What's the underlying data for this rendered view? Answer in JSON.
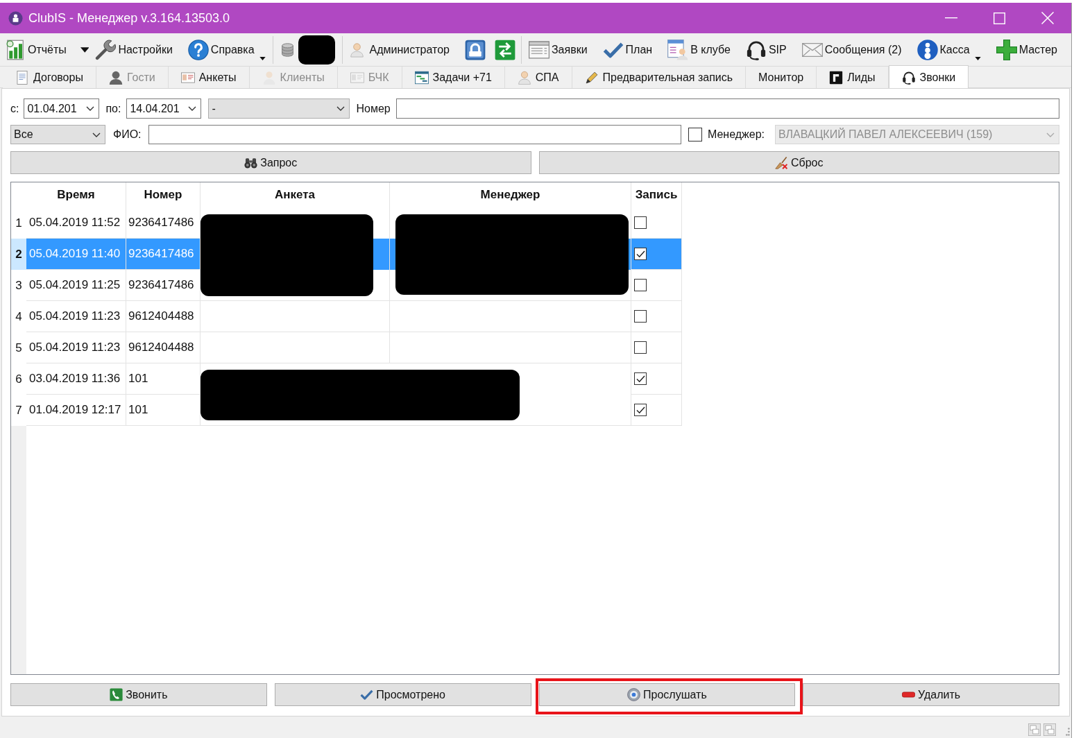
{
  "window": {
    "title": "ClubIS - Менеджер v.3.164.13503.0"
  },
  "toolbar": {
    "groups": [
      [
        {
          "kind": "split",
          "label": "Отчёты"
        },
        {
          "kind": "button",
          "label": "Настройки",
          "menu": false
        },
        {
          "kind": "button",
          "label": "Справка",
          "menu": true
        }
      ],
      [
        {
          "kind": "redacted"
        }
      ],
      [
        {
          "kind": "button",
          "label": "Администратор",
          "menu": false
        },
        {
          "kind": "icon"
        },
        {
          "kind": "icon"
        }
      ]
    ],
    "right": [
      {
        "kind": "button",
        "label": "Заявки",
        "menu": false
      },
      {
        "kind": "button",
        "label": "План",
        "menu": false
      },
      {
        "kind": "button",
        "label": "В клубе",
        "menu": false
      },
      {
        "kind": "button",
        "label": "SIP",
        "menu": false
      },
      {
        "kind": "button",
        "label": "Сообщения (2)",
        "menu": false
      },
      {
        "kind": "button",
        "label": "Касса",
        "menu": true
      },
      {
        "kind": "button",
        "label": "Мастер",
        "menu": false
      }
    ]
  },
  "tabs": [
    {
      "label": "Договоры",
      "selected": false,
      "disabled": false
    },
    {
      "label": "Гости",
      "selected": false,
      "disabled": true
    },
    {
      "label": "Анкеты",
      "selected": false,
      "disabled": false
    },
    {
      "label": "Клиенты",
      "selected": false,
      "disabled": true
    },
    {
      "label": "БЧК",
      "selected": false,
      "disabled": true
    },
    {
      "label": "Задачи +71",
      "selected": false,
      "disabled": false
    },
    {
      "label": "СПА",
      "selected": false,
      "disabled": false
    },
    {
      "label": "Предварительная запись",
      "selected": false,
      "disabled": false
    },
    {
      "label": "Монитор",
      "selected": false,
      "disabled": false
    },
    {
      "label": "Лиды",
      "selected": false,
      "disabled": false
    },
    {
      "label": "Звонки",
      "selected": true,
      "disabled": false
    }
  ],
  "filters": {
    "date_from": {
      "label": "с:",
      "value": "01.04.201"
    },
    "date_to": {
      "label": "по:",
      "value": "14.04.201"
    },
    "status": {
      "value": "-"
    },
    "number": {
      "label": "Номер"
    },
    "type": {
      "value": "Все"
    },
    "name": {
      "label": "ФИО:"
    },
    "manager": {
      "label": "Менеджер:",
      "checked": false,
      "value": "ВЛАВАЦКИЙ ПАВЕЛ АЛЕКСЕЕВИЧ (159)",
      "disabled": true
    },
    "buttons": [
      {
        "label": "Запрос"
      },
      {
        "label": "Сброс"
      }
    ]
  },
  "table": {
    "columns": [
      "Время",
      "Номер",
      "Анкета",
      "Менеджер",
      "Запись"
    ],
    "rows": [
      {
        "number": "1",
        "time": "05.04.2019 11:52",
        "phone": "9236417486",
        "form_redacted": true,
        "manager_redacted": true,
        "recorded": false,
        "selected": false
      },
      {
        "number": "2",
        "time": "05.04.2019 11:40",
        "phone": "9236417486",
        "form_redacted": true,
        "manager_redacted": true,
        "recorded": true,
        "selected": true
      },
      {
        "number": "3",
        "time": "05.04.2019 11:25",
        "phone": "9236417486",
        "form_redacted": true,
        "manager_redacted": true,
        "recorded": false,
        "selected": false
      },
      {
        "number": "4",
        "time": "05.04.2019 11:23",
        "phone": "9612404488",
        "form_redacted": false,
        "manager_redacted": false,
        "recorded": false,
        "selected": false
      },
      {
        "number": "5",
        "time": "05.04.2019 11:23",
        "phone": "9612404488",
        "form_redacted": false,
        "manager_redacted": false,
        "recorded": false,
        "selected": false
      },
      {
        "number": "6",
        "time": "03.04.2019 11:36",
        "phone": "101",
        "form_redacted": true,
        "manager_redacted": false,
        "recorded": true,
        "selected": false
      },
      {
        "number": "7",
        "time": "01.04.2019 12:17",
        "phone": "101",
        "form_redacted": true,
        "manager_redacted": false,
        "recorded": true,
        "selected": false
      }
    ]
  },
  "actions": [
    {
      "label": "Звонить",
      "highlighted": false
    },
    {
      "label": "Просмотрено",
      "highlighted": false
    },
    {
      "label": "Прослушать",
      "highlighted": true
    },
    {
      "label": "Удалить",
      "highlighted": false
    }
  ]
}
